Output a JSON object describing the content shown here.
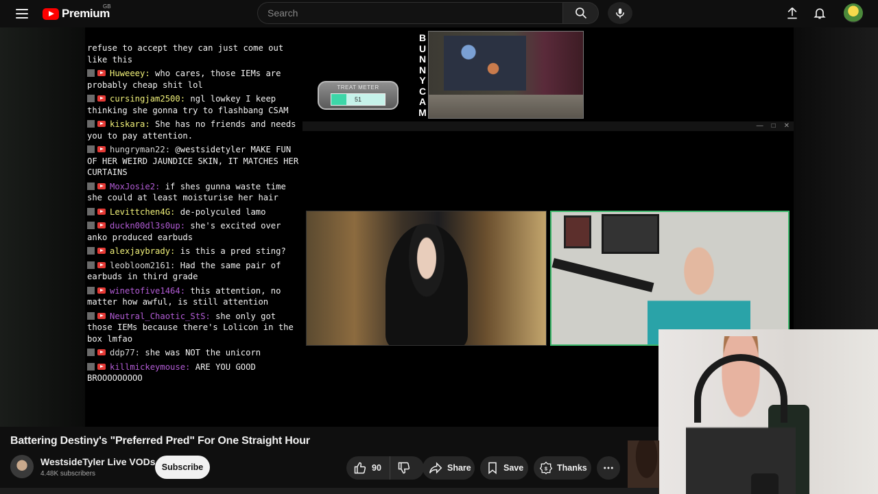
{
  "header": {
    "logo_text": "Premium",
    "region": "GB",
    "search_placeholder": "Search"
  },
  "chat": [
    {
      "user": "",
      "text": "refuse to accept they can just come out like this",
      "color": "gray",
      "continuation": true
    },
    {
      "user": "Huweeey:",
      "text": " who cares, those IEMs are probably cheap shit lol",
      "color": "yellow"
    },
    {
      "user": "cursingjam2500:",
      "text": " ngl lowkey I keep thinking she gonna try to flashbang CSAM",
      "color": "yellow"
    },
    {
      "user": "kiskara:",
      "text": " She has no friends and needs you to pay attention.",
      "color": "yellow"
    },
    {
      "user": "hungryman22:",
      "text": " @westsidetyler MAKE FUN OF HER WEIRD JAUNDICE SKIN, IT MATCHES HER CURTAINS",
      "color": "gray"
    },
    {
      "user": "MoxJosie2:",
      "text": " if shes gunna waste time she could at least moisturise her hair",
      "color": "purple"
    },
    {
      "user": "Levittchen4G:",
      "text": " de-polyculed lamo",
      "color": "yellow"
    },
    {
      "user": "duckn00dl3s0up:",
      "text": " she's excited over anko produced earbuds",
      "color": "purple"
    },
    {
      "user": "alexjaybrady:",
      "text": " is this a pred sting?",
      "color": "yellow"
    },
    {
      "user": "leobloom2161:",
      "text": " Had the same pair of earbuds in third grade",
      "color": "gray"
    },
    {
      "user": "winetofive1464:",
      "text": " this attention, no matter how awful, is still attention",
      "color": "purple"
    },
    {
      "user": "Neutral_Chaotic_StS:",
      "text": " she only got those IEMs because there's Lolicon in the box lmfao",
      "color": "purple"
    },
    {
      "user": "ddp77:",
      "text": " she was NOT the unicorn",
      "color": "gray"
    },
    {
      "user": "killmickeymouse:",
      "text": " ARE YOU GOOD BROOOOOOOOO",
      "color": "purple"
    }
  ],
  "overlay": {
    "treat_meter_label": "TREAT METER",
    "treat_meter_value": "51",
    "treat_meter_fraction": 0.28,
    "bunny_cam_label": [
      "B",
      "U",
      "N",
      "N",
      "Y",
      "C",
      "A",
      "M"
    ]
  },
  "video_info": {
    "title": "Battering Destiny's \"Preferred Pred\" For One Straight Hour",
    "channel_name": "WestsideTyler Live VODs",
    "subscribers": "4.48K subscribers",
    "subscribe_label": "Subscribe",
    "likes": "90",
    "share_label": "Share",
    "save_label": "Save",
    "thanks_label": "Thanks"
  },
  "icons": {
    "menu": "menu-icon",
    "search": "search-icon",
    "mic": "mic-icon",
    "upload": "upload-icon",
    "bell": "bell-icon",
    "like": "thumbs-up-icon",
    "dislike": "thumbs-down-icon",
    "share": "share-icon",
    "save": "bookmark-icon",
    "thanks": "thanks-icon",
    "more": "more-horizontal-icon"
  },
  "colors": {
    "accent": "#ff0000",
    "background": "#0f0f0f",
    "chat_yellow": "#f2f27a",
    "chat_purple": "#b35cd6",
    "cam_border": "#3cb86b"
  }
}
